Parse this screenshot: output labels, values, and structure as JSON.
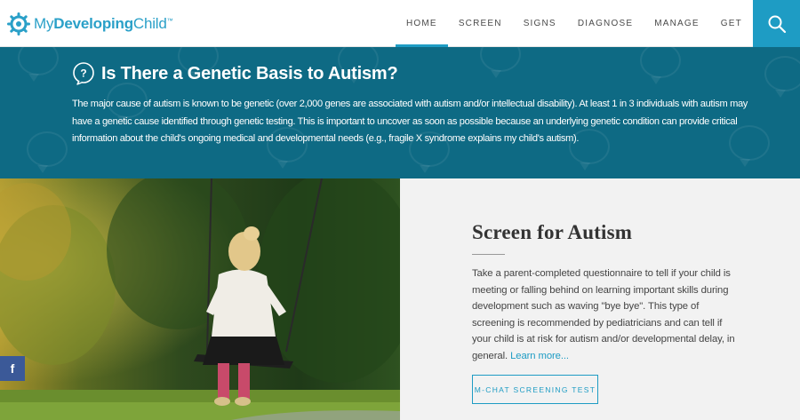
{
  "brand": {
    "part1": "My",
    "part2": "Developing",
    "part3": "Child",
    "tm": "™"
  },
  "nav": {
    "items": [
      {
        "label": "HOME",
        "active": true
      },
      {
        "label": "SCREEN",
        "active": false
      },
      {
        "label": "SIGNS",
        "active": false
      },
      {
        "label": "DIAGNOSE",
        "active": false
      },
      {
        "label": "MANAGE",
        "active": false
      },
      {
        "label": "GET SUPPORT",
        "active": false
      }
    ],
    "search_icon": "search-icon"
  },
  "banner": {
    "icon": "question-bubble-icon",
    "title": "Is There a Genetic Basis to Autism?",
    "text": "The major cause of autism is known to be genetic (over 2,000 genes are associated with autism and/or intellectual disability). At least 1 in 3 individuals with autism may have a genetic cause identified through genetic testing. This is important to uncover as soon as possible because an underlying genetic condition can provide critical information about the child's ongoing medical and developmental needs (e.g., fragile X syndrome explains my child's autism)."
  },
  "social": {
    "facebook_label": "f"
  },
  "screen_panel": {
    "title": "Screen for Autism",
    "text": "Take a parent-completed questionnaire to tell if your child is meeting or falling behind on learning important skills during development such as waving \"bye bye\". This type of screening is recommended by pediatricians and can tell if your child is at risk for autism and/or developmental delay, in general.",
    "link": "Learn more...",
    "button": "M-CHAT SCREENING TEST"
  },
  "colors": {
    "accent": "#1e9cc4",
    "banner_bg": "#0e6a84",
    "panel_bg": "#f2f2f2",
    "facebook": "#3b5998"
  }
}
